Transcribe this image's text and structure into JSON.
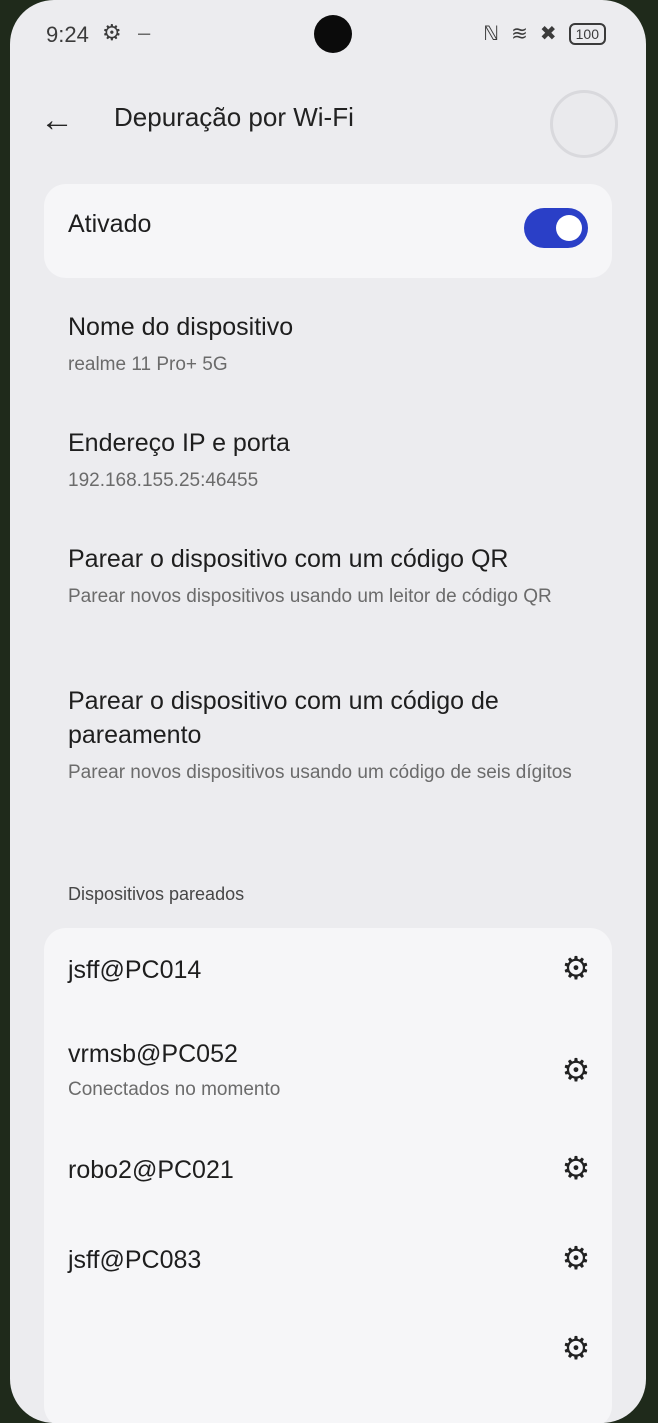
{
  "status_bar": {
    "time": "9:24",
    "gear_glyph": "⚙",
    "dash": "–",
    "nfc_glyph": "ℕ",
    "wifi_glyph": "≋",
    "sim_glyph": "✖",
    "battery": "100"
  },
  "toolbar": {
    "title": "Depuração por Wi-Fi"
  },
  "toggle": {
    "label": "Ativado",
    "on": true
  },
  "items": [
    {
      "title": "Nome do dispositivo",
      "subtitle": "realme 11 Pro+ 5G"
    },
    {
      "title": "Endereço IP e porta",
      "subtitle": "192.168.155.25:46455"
    },
    {
      "title": "Parear o dispositivo com um código QR",
      "subtitle": "Parear novos dispositivos usando um leitor de código QR"
    },
    {
      "title": "Parear o dispositivo com um código de pareamento",
      "subtitle": "Parear novos dispositivos usando um código de seis dígitos"
    }
  ],
  "paired_section": {
    "title": "Dispositivos pareados",
    "devices": [
      {
        "name": "jsff@PC014",
        "status": ""
      },
      {
        "name": "vrmsb@PC052",
        "status": "Conectados no momento"
      },
      {
        "name": "robo2@PC021",
        "status": ""
      },
      {
        "name": "jsff@PC083",
        "status": ""
      }
    ]
  },
  "icons": {
    "back": "←",
    "settings": "⚙"
  },
  "colors": {
    "toggle_on": "#2a3fc7",
    "background": "#ececef",
    "card": "#f6f6f8"
  }
}
